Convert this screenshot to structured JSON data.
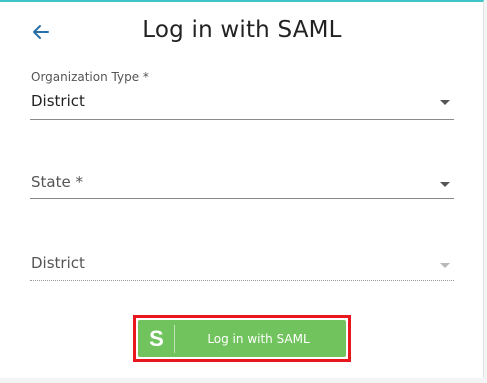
{
  "header": {
    "title": "Log in with SAML",
    "back_icon": "arrow-left-icon"
  },
  "colors": {
    "accent_top_border": "#3fc6c8",
    "back_icon": "#2a6fa6",
    "saml_button": "#71c35e",
    "highlight_border": "#e8171d"
  },
  "form": {
    "organization_type": {
      "label": "Organization Type *",
      "value": "District"
    },
    "state": {
      "label": "State *",
      "value": ""
    },
    "district": {
      "label": "District",
      "value": "",
      "disabled": true
    }
  },
  "saml_button": {
    "logo_letter": "S",
    "label": "Log in with SAML"
  }
}
